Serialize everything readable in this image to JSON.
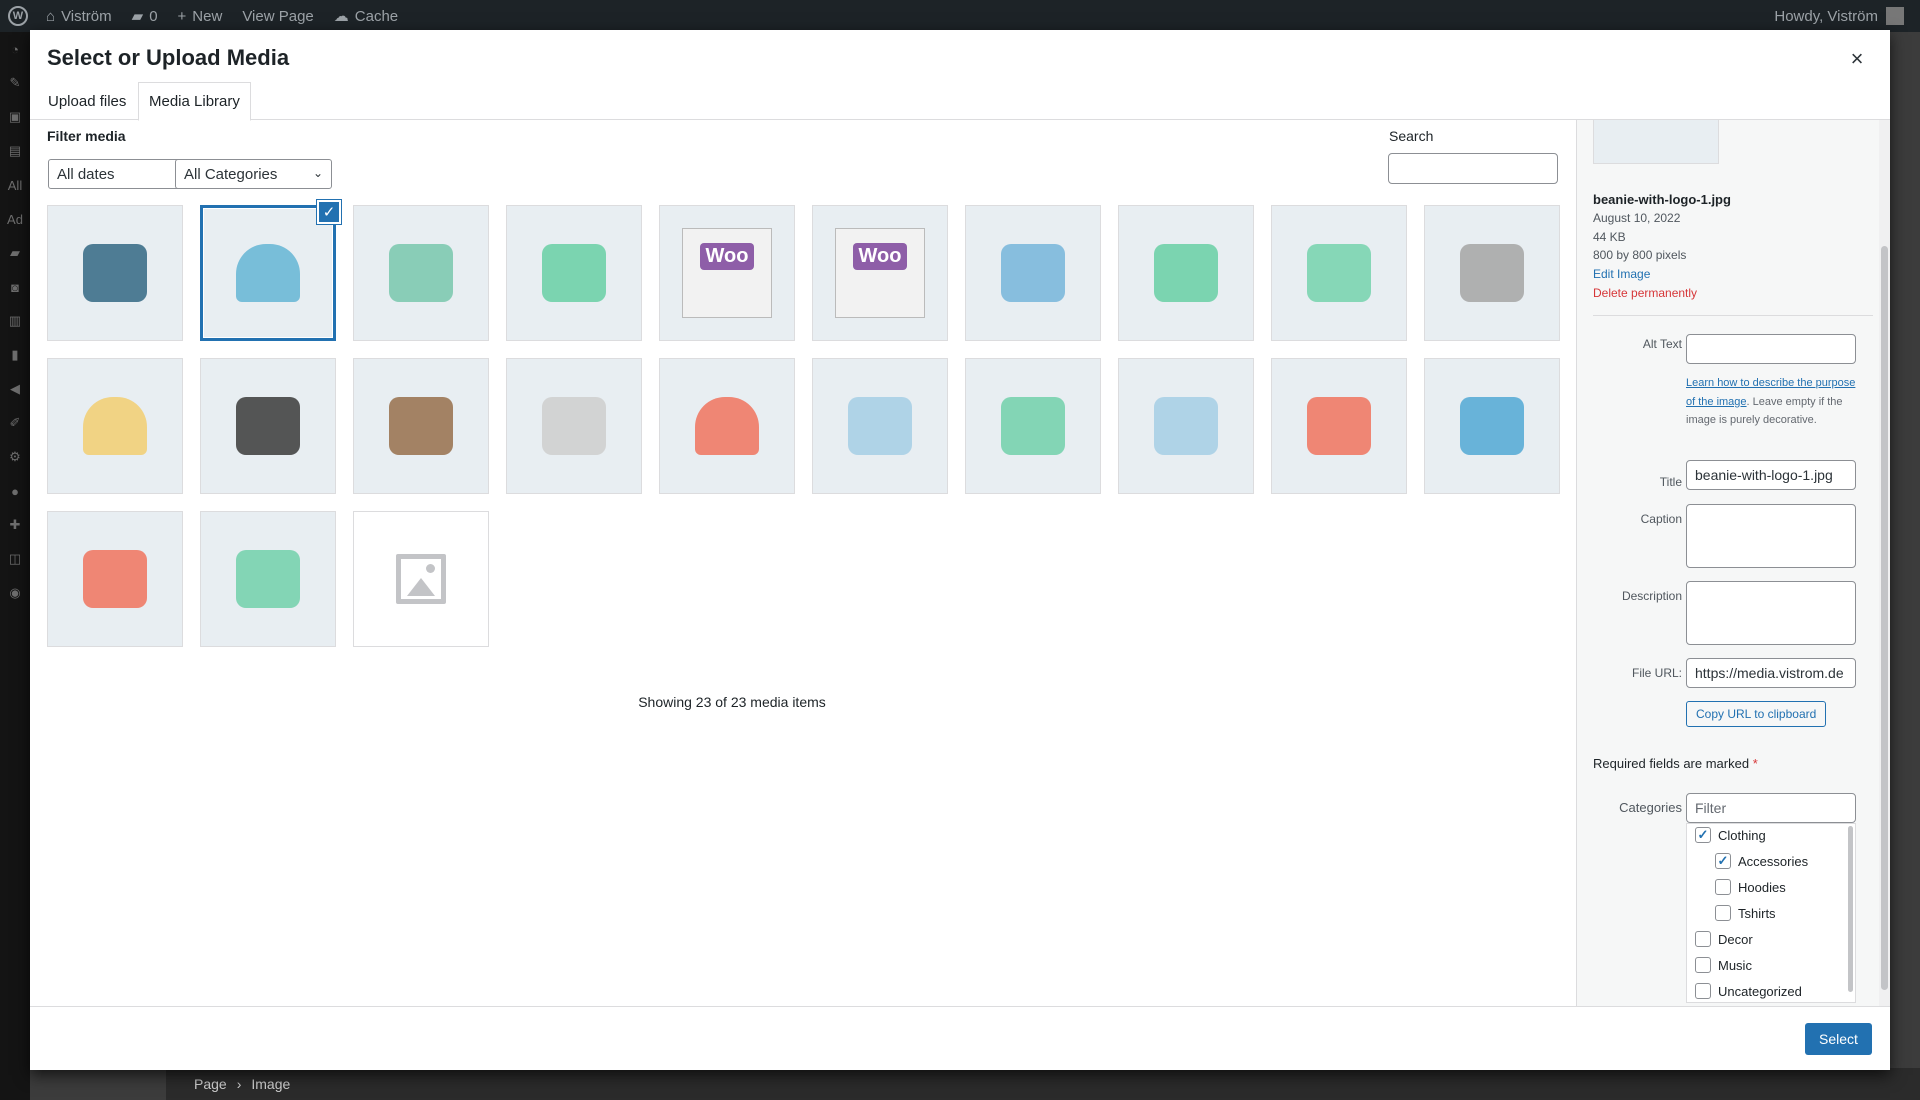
{
  "adminbar": {
    "site_name": "Viström",
    "comments_count": "0",
    "new_label": "New",
    "view_page_label": "View Page",
    "cache_label": "Cache",
    "howdy": "Howdy, Viström"
  },
  "background": {
    "breadcrumb_page": "Page",
    "breadcrumb_sep": "›",
    "breadcrumb_image": "Image",
    "menu_labels": [
      "All",
      "Ad"
    ]
  },
  "modal": {
    "title": "Select or Upload Media",
    "close_icon": "×",
    "tabs": [
      "Upload files",
      "Media Library"
    ],
    "active_tab": "Media Library"
  },
  "filters": {
    "label": "Filter media",
    "dates": "All dates",
    "categories": "All Categories",
    "search_label": "Search",
    "search_value": ""
  },
  "media_items": [
    {
      "name": "pennant",
      "color": "#3d6f8a",
      "selected": false
    },
    {
      "name": "beanie-with-logo",
      "color": "#6bb8d6",
      "selected": true
    },
    {
      "name": "hoodie-tshirt-beanie-set",
      "color": "#7ec9b0",
      "selected": false
    },
    {
      "name": "tshirt-with-logo",
      "color": "#6fd0a8",
      "selected": false
    },
    {
      "name": "woo-single",
      "color": "#8e5ea8",
      "selected": false
    },
    {
      "name": "woo-album",
      "color": "#8e5ea8",
      "selected": false
    },
    {
      "name": "polo",
      "color": "#7cb8dc",
      "selected": false
    },
    {
      "name": "hoodie-with-zipper",
      "color": "#6fd0a8",
      "selected": false
    },
    {
      "name": "long-sleeve-tee",
      "color": "#7bd4b0",
      "selected": false
    },
    {
      "name": "hoodie-gray",
      "color": "#a8a8a8",
      "selected": false
    },
    {
      "name": "cap",
      "color": "#f2cf78",
      "selected": false
    },
    {
      "name": "sunglasses",
      "color": "#444444",
      "selected": false
    },
    {
      "name": "belt",
      "color": "#9b7654",
      "selected": false
    },
    {
      "name": "tshirt-gray",
      "color": "#cfcfcf",
      "selected": false
    },
    {
      "name": "beanie-red",
      "color": "#ef7a66",
      "selected": false
    },
    {
      "name": "hoodie-with-logo",
      "color": "#a9cfe6",
      "selected": false
    },
    {
      "name": "hoodie-green",
      "color": "#78d2ae",
      "selected": false
    },
    {
      "name": "hoodie-blue",
      "color": "#a9cfe6",
      "selected": false
    },
    {
      "name": "hoodie-red",
      "color": "#ef7a66",
      "selected": false
    },
    {
      "name": "vneck-tee-blue",
      "color": "#5aacd6",
      "selected": false
    },
    {
      "name": "vneck-tee-red",
      "color": "#ef7a66",
      "selected": false
    },
    {
      "name": "vneck-tee-green",
      "color": "#78d2ae",
      "selected": false
    },
    {
      "name": "placeholder",
      "color": "#c3c4c7",
      "selected": false
    }
  ],
  "status": {
    "showing": "Showing 23 of 23 media items"
  },
  "details": {
    "filename": "beanie-with-logo-1.jpg",
    "date": "August 10, 2022",
    "filesize": "44 KB",
    "dimensions": "800 by 800 pixels",
    "edit_link": "Edit Image",
    "delete_link": "Delete permanently",
    "alt_label": "Alt Text",
    "alt_value": "",
    "alt_help_link": "Learn how to describe the purpose of the image",
    "alt_help_text": ". Leave empty if the image is purely decorative.",
    "title_label": "Title",
    "title_value": "beanie-with-logo-1.jpg",
    "caption_label": "Caption",
    "description_label": "Description",
    "fileurl_label": "File URL:",
    "fileurl_value": "https://media.vistrom.de",
    "copy_button": "Copy URL to clipboard",
    "required_note": "Required fields are marked",
    "required_star": "*",
    "categories_label": "Categories",
    "categories_filter_placeholder": "Filter",
    "categories": [
      {
        "label": "Clothing",
        "checked": true,
        "level": 0
      },
      {
        "label": "Accessories",
        "checked": true,
        "level": 1
      },
      {
        "label": "Hoodies",
        "checked": false,
        "level": 1
      },
      {
        "label": "Tshirts",
        "checked": false,
        "level": 1
      },
      {
        "label": "Decor",
        "checked": false,
        "level": 0
      },
      {
        "label": "Music",
        "checked": false,
        "level": 0
      },
      {
        "label": "Uncategorized",
        "checked": false,
        "level": 0
      }
    ]
  },
  "footer": {
    "select_button": "Select"
  },
  "colors": {
    "accent": "#2271b1",
    "danger": "#d63638",
    "adminbar": "#1d2327"
  }
}
